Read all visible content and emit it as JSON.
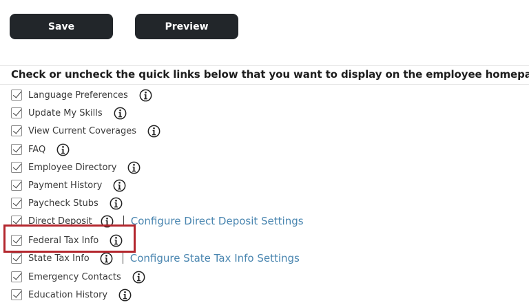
{
  "toolbar": {
    "save_label": "Save",
    "preview_label": "Preview"
  },
  "instructions": "Check or uncheck the quick links below that you want to display on the employee homepage.",
  "quick_links": [
    {
      "label": "Language Preferences",
      "checked": true
    },
    {
      "label": "Update My Skills",
      "checked": true
    },
    {
      "label": "View Current Coverages",
      "checked": true
    },
    {
      "label": "FAQ",
      "checked": true
    },
    {
      "label": "Employee Directory",
      "checked": true
    },
    {
      "label": "Payment History",
      "checked": true
    },
    {
      "label": "Paycheck Stubs",
      "checked": true
    },
    {
      "label": "Direct Deposit",
      "checked": true,
      "config_link": "Configure Direct Deposit Settings"
    },
    {
      "label": "Federal Tax Info",
      "checked": true,
      "highlighted": true
    },
    {
      "label": "State Tax Info",
      "checked": true,
      "config_link": "Configure State Tax Info Settings"
    },
    {
      "label": "Emergency Contacts",
      "checked": true
    },
    {
      "label": "Education History",
      "checked": true
    }
  ],
  "icons": {
    "info": "info-circle-icon",
    "checkbox": "checkmark-icon"
  },
  "colors": {
    "button_bg": "#22262a",
    "link": "#4a86b0",
    "highlight_border": "#b3262d"
  }
}
